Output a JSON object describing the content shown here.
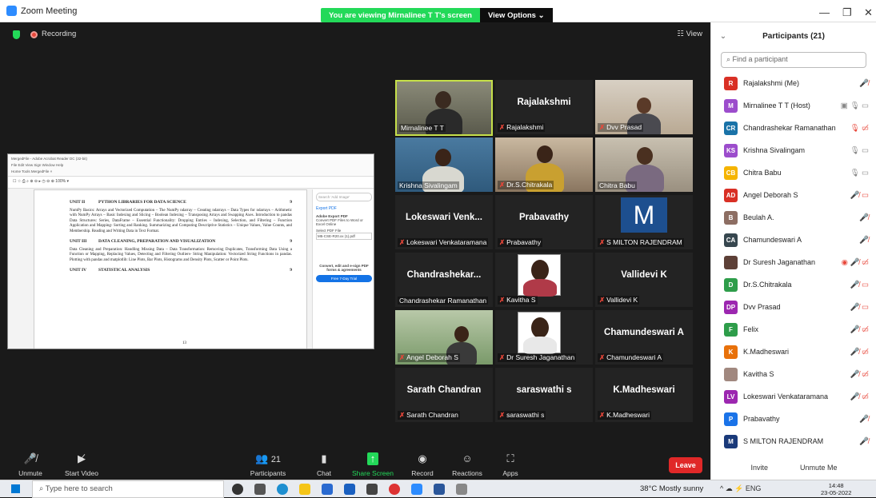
{
  "app": {
    "title": "Zoom Meeting"
  },
  "banner": {
    "viewing": "You are viewing Mirnalinee T T's screen",
    "view_options": "View Options ⌄"
  },
  "meeting": {
    "recording": "Recording",
    "view": "☷ View"
  },
  "pdf": {
    "units": [
      {
        "num": "UNIT II",
        "title": "PYTHON LIBRARIES FOR DATA SCIENCE",
        "hours": "9",
        "body": "NumPy Basics: Arrays and Vectorized Computation – The NumPy ndarray – Creating ndarrays – Data Types for ndarrays – Arithmetic with NumPy Arrays – Basic Indexing and Slicing – Boolean Indexing – Transposing Arrays and Swapping Axes. Introduction to pandas Data Structures: Series, DataFrame – Essential Functionality: Dropping Entries – Indexing, Selection, and Filtering – Function Application and Mapping- Sorting and Ranking. Summarizing and Computing Descriptive Statistics – Unique Values, Value Counts, and Membership. Reading and Writing Data in Text Format."
      },
      {
        "num": "UNIT III",
        "title": "DATA CLEANING, PREPARATION AND VISUALIZATION",
        "hours": "9",
        "body": "Data Cleaning and Preparation: Handling Missing Data – Data Transformation: Removing Duplicates, Transforming Data Using a Function or Mapping, Replacing Values, Detecting and Filtering Outliers- String Manipulation: Vectorized String Functions in pandas. Plotting with pandas and matplotlib: Line Plots, Bar Plots, Histograms and Density Plots, Scatter or Point Plots."
      },
      {
        "num": "UNIT IV",
        "title": "STATISTICAL ANALYSIS",
        "hours": "9",
        "body": ""
      }
    ],
    "page_number": "13",
    "side": {
      "search": "Search 'Add Image'",
      "export": "Export PDF",
      "adobe": "Adobe Export PDF",
      "convert": "Convert PDF Files to Word or Excel Online",
      "select": "Select PDF File",
      "file": "M5-CSE-R20.xx (1).pdf",
      "promo": "Convert, edit and e-sign PDF forms & agreements",
      "trial": "Free 7-Day Trial"
    }
  },
  "tiles": [
    {
      "label": "Mirnalinee T T",
      "big": "",
      "muted": false
    },
    {
      "label": "Rajalakshmi",
      "big": "Rajalakshmi",
      "muted": true
    },
    {
      "label": "Dvv Prasad",
      "big": "",
      "muted": true
    },
    {
      "label": "Krishna Sivalingam",
      "big": "",
      "muted": false
    },
    {
      "label": "Dr.S.Chitrakala",
      "big": "",
      "muted": true
    },
    {
      "label": "Chitra Babu",
      "big": "",
      "muted": false
    },
    {
      "label": "Lokeswari Venkataramana",
      "big": "Lokeswari Venk...",
      "muted": true
    },
    {
      "label": "Prabavathy",
      "big": "Prabavathy",
      "muted": true
    },
    {
      "label": "S MILTON RAJENDRAM",
      "big": "M",
      "muted": true
    },
    {
      "label": "Chandrashekar Ramanathan",
      "big": "Chandrashekar...",
      "muted": false
    },
    {
      "label": "Kavitha S",
      "big": "",
      "muted": true
    },
    {
      "label": "Vallidevi K",
      "big": "Vallidevi K",
      "muted": true
    },
    {
      "label": "Angel Deborah S",
      "big": "",
      "muted": true
    },
    {
      "label": "Dr Suresh Jaganathan",
      "big": "",
      "muted": true
    },
    {
      "label": "Chamundeswari A",
      "big": "Chamundeswari A",
      "muted": true
    },
    {
      "label": "Sarath Chandran",
      "big": "Sarath Chandran",
      "muted": true
    },
    {
      "label": "saraswathi s",
      "big": "saraswathi s",
      "muted": true
    },
    {
      "label": "K.Madheswari",
      "big": "K.Madheswari",
      "muted": true
    }
  ],
  "toolbar": {
    "unmute": "Unmute",
    "start_video": "Start Video",
    "participants": "Participants",
    "participants_count": "21",
    "chat": "Chat",
    "share": "Share Screen",
    "record": "Record",
    "reactions": "Reactions",
    "apps": "Apps",
    "leave": "Leave"
  },
  "panel": {
    "title": "Participants (21)",
    "search": "Find a participant",
    "invite": "Invite",
    "unmute_me": "Unmute Me",
    "participants": [
      {
        "initials": "R",
        "name": "Rajalakshmi (Me)",
        "color": "#d93025",
        "icons": "🎤̸"
      },
      {
        "initials": "M",
        "name": "Mirnalinee T T (Host)",
        "color": "#9c4dcc",
        "icons": "▣ 🎙 ▭"
      },
      {
        "initials": "CR",
        "name": "Chandrashekar Ramanathan",
        "color": "#1a73a8",
        "icons": "🎙 ▭̸"
      },
      {
        "initials": "KS",
        "name": "Krishna Sivalingam",
        "color": "#9c4dcc",
        "icons": "🎙 ▭"
      },
      {
        "initials": "CB",
        "name": "Chitra Babu",
        "color": "#f5b400",
        "icons": "🎙 ▭"
      },
      {
        "initials": "AD",
        "name": "Angel Deborah S",
        "color": "#d93025",
        "icons": "🎤̸ ▭"
      },
      {
        "initials": "B",
        "name": "Beulah A.",
        "color": "#8d6e63",
        "icons": "🎤̸"
      },
      {
        "initials": "CA",
        "name": "Chamundeswari A",
        "color": "#37474f",
        "icons": "🎤̸"
      },
      {
        "initials": "",
        "name": "Dr Suresh Jaganathan",
        "color": "#5d4037",
        "icons": "◉ 🎤̸ ▭̸"
      },
      {
        "initials": "D",
        "name": "Dr.S.Chitrakala",
        "color": "#2e9d4a",
        "icons": "🎤̸ ▭"
      },
      {
        "initials": "DP",
        "name": "Dvv Prasad",
        "color": "#9c27b0",
        "icons": "🎤̸ ▭"
      },
      {
        "initials": "F",
        "name": "Felix",
        "color": "#2e9d4a",
        "icons": "🎤̸ ▭̸"
      },
      {
        "initials": "K",
        "name": "K.Madheswari",
        "color": "#e8710a",
        "icons": "🎤̸ ▭̸"
      },
      {
        "initials": "",
        "name": "Kavitha S",
        "color": "#a1887f",
        "icons": "🎤̸ ▭̸"
      },
      {
        "initials": "LV",
        "name": "Lokeswari Venkataramana",
        "color": "#9c27b0",
        "icons": "🎤̸ ▭̸"
      },
      {
        "initials": "P",
        "name": "Prabavathy",
        "color": "#1a73e8",
        "icons": "🎤̸"
      },
      {
        "initials": "M",
        "name": "S MILTON RAJENDRAM",
        "color": "#1a3a7a",
        "icons": "🎤̸"
      }
    ]
  },
  "taskbar": {
    "search": "Type here to search",
    "weather": "38°C  Mostly sunny",
    "tray": "^  ☁  ⚡  ENG",
    "time": "14:48",
    "date": "23-05-2022"
  }
}
